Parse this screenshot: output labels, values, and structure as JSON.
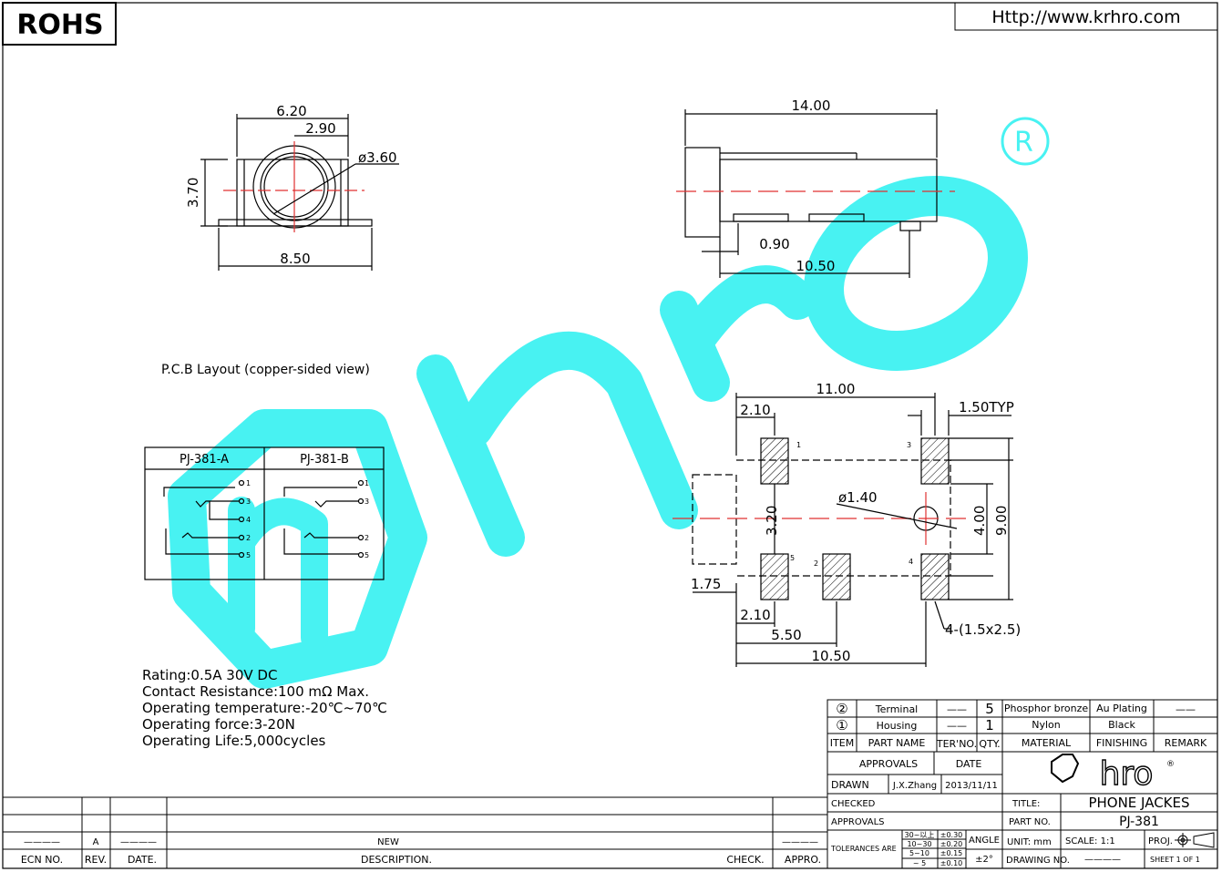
{
  "header": {
    "rohs": "ROHS",
    "url": "Http://www.krhro.com"
  },
  "front_view": {
    "d_total": "6.20",
    "d_half": "2.90",
    "d_dia": "ø3.60",
    "d_height": "3.70",
    "d_base": "8.50"
  },
  "side_view": {
    "d_length": "14.00",
    "d_pin": "0.90",
    "d_span": "10.50"
  },
  "pcb": {
    "title": "P.C.B Layout (copper-sided view)",
    "d_width": "11.00",
    "d_left": "2.10",
    "d_pad": "1.50TYP",
    "d_hole": "ø1.40",
    "d_inner": "3.20",
    "d_mid": "4.00",
    "d_height": "9.00",
    "d_offset": "1.75",
    "d_left2": "2.10",
    "d_pin2": "5.50",
    "d_bottom": "10.50",
    "d_pads": "4-(1.5x2.5)",
    "pins": [
      "1",
      "2",
      "3",
      "4",
      "5"
    ]
  },
  "schematic": {
    "col_a": "PJ-381-A",
    "col_b": "PJ-381-B",
    "a_pins": [
      "1",
      "3",
      "4",
      "2",
      "5"
    ],
    "b_pins": [
      "1",
      "3",
      "2",
      "5"
    ]
  },
  "specs": [
    "Rating:0.5A 30V DC",
    "Contact Resistance:100 mΩ Max.",
    "Operating temperature:-20℃~70℃",
    "Operating force:3-20N",
    "Operating Life:5,000cycles"
  ],
  "bom": {
    "rows": [
      {
        "item": "②",
        "part": "Terminal",
        "ter": "——",
        "qty": "5",
        "material": "Phosphor bronze",
        "finishing": "Au Plating",
        "remark": "——"
      },
      {
        "item": "①",
        "part": "Housing",
        "ter": "——",
        "qty": "1",
        "material": "Nylon",
        "finishing": "Black",
        "remark": ""
      }
    ],
    "headers": {
      "item": "ITEM",
      "part": "PART NAME",
      "ter": "TER'NO.",
      "qty": "QTY.",
      "material": "MATERIAL",
      "finishing": "FINISHING",
      "remark": "REMARK"
    }
  },
  "title_block": {
    "approvals": "APPROVALS",
    "date": "DATE",
    "drawn": "DRAWN",
    "drawn_by": "J.X.Zhang",
    "drawn_date": "2013/11/11",
    "checked": "CHECKED",
    "approvals2": "APPROVALS",
    "brand": "hro",
    "title_label": "TITLE:",
    "title": "PHONE JACKES",
    "part_label": "PART NO.",
    "part": "PJ-381",
    "tol_label": "TOLERANCES ARE",
    "tol": [
      {
        "range": "30~以上",
        "value": "±0.30"
      },
      {
        "range": "10~30",
        "value": "±0.20"
      },
      {
        "range": "5~10",
        "value": "±0.15"
      },
      {
        "range": "~ 5",
        "value": "±0.10"
      }
    ],
    "angle_label": "ANGLE",
    "angle": "±2°",
    "unit": "UNIT: mm",
    "scale": "SCALE:  1:1",
    "proj": "PROJ.",
    "drawing_label": "DRAWING NO.",
    "drawing": "————",
    "sheet": "SHEET  1 OF 1"
  },
  "revision": {
    "row": {
      "ecn": "————",
      "rev": "A",
      "date": "————",
      "desc": "NEW",
      "check": "",
      "appro": "————"
    },
    "headers": {
      "ecn": "ECN NO.",
      "rev": "REV.",
      "date": "DATE.",
      "desc": "DESCRIPTION.",
      "check": "CHECK.",
      "appro": "APPRO."
    }
  },
  "colors": {
    "watermark": "#3ff2f2",
    "center_line": "#e03030",
    "line": "#000000"
  }
}
